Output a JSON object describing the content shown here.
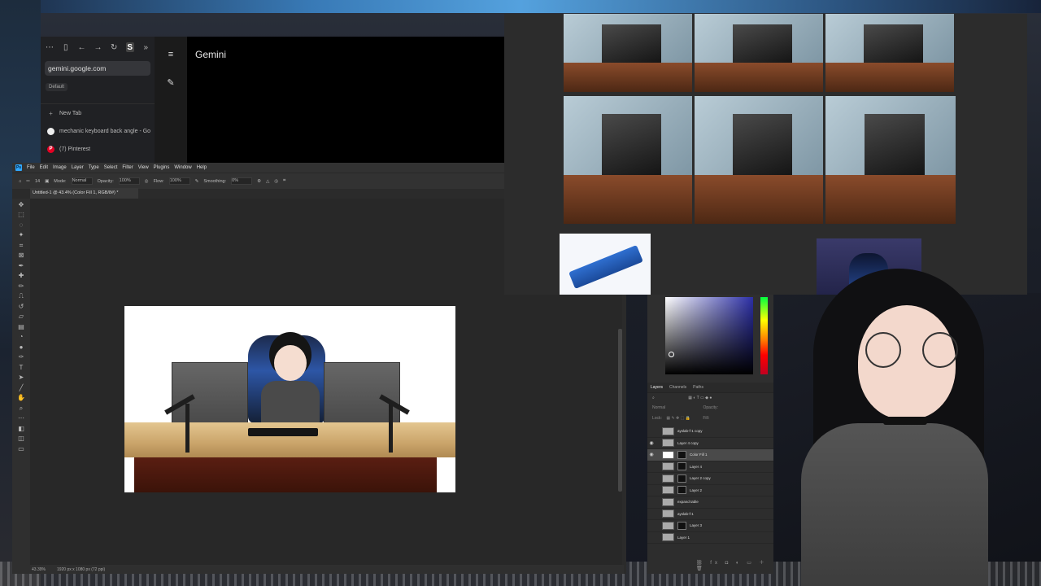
{
  "browser": {
    "url": "gemini.google.com",
    "profile": "Default",
    "new_tab_label": "New Tab",
    "tabs": [
      {
        "label": "mechanic keyboard back angle - Go",
        "icon": "google-icon"
      },
      {
        "label": "(7) Pinterest",
        "icon": "pinterest-icon"
      }
    ],
    "icons": [
      "more-icon",
      "sidebar-icon",
      "back-arrow-icon",
      "forward-arrow-icon",
      "reload-icon",
      "extension-s-icon",
      "expand-icon"
    ]
  },
  "gemini": {
    "title": "Gemini",
    "menu_icon": "menu-icon",
    "new_chat_icon": "edit-icon"
  },
  "photoshop": {
    "menu": [
      "File",
      "Edit",
      "Image",
      "Layer",
      "Type",
      "Select",
      "Filter",
      "View",
      "Plugins",
      "Window",
      "Help"
    ],
    "options": {
      "mode_label": "Mode:",
      "mode_value": "Normal",
      "opacity_label": "Opacity:",
      "opacity_value": "100%",
      "flow_label": "Flow:",
      "flow_value": "100%",
      "smoothing_label": "Smoothing:",
      "smoothing_value": "0%",
      "brush_size": "14"
    },
    "doc_tab": "Untitled-1 @ 43.4% (Color Fill 1, RGB/8#) *",
    "status_zoom": "43.39%",
    "status_size": "1920 px x 1080 px (72 ppi)",
    "panel_tabs": [
      "Layers",
      "Channels",
      "Paths"
    ],
    "blend_mode": "Normal",
    "opacity_label": "Opacity:",
    "lock_label": "Lock:",
    "fill_label": "Fill:",
    "layers": [
      {
        "name": "ayslab-f-1 copy",
        "visible": false,
        "selected": false
      },
      {
        "name": "Layer 4 copy",
        "visible": true,
        "selected": false
      },
      {
        "name": "Color Fill 1",
        "visible": true,
        "selected": true
      },
      {
        "name": "Layer 4",
        "visible": false,
        "selected": false
      },
      {
        "name": "Layer 2 copy",
        "visible": false,
        "selected": false
      },
      {
        "name": "Layer 2",
        "visible": false,
        "selected": false
      },
      {
        "name": "expand table",
        "visible": false,
        "selected": false
      },
      {
        "name": "ayslab-f-1",
        "visible": false,
        "selected": false
      },
      {
        "name": "Layer 3",
        "visible": false,
        "selected": false
      },
      {
        "name": "Layer 1",
        "visible": false,
        "selected": false
      }
    ],
    "colors": {
      "accent": "#31a8ff",
      "panel": "#2d2d2d",
      "selected_row": "#4a4a4a"
    }
  }
}
